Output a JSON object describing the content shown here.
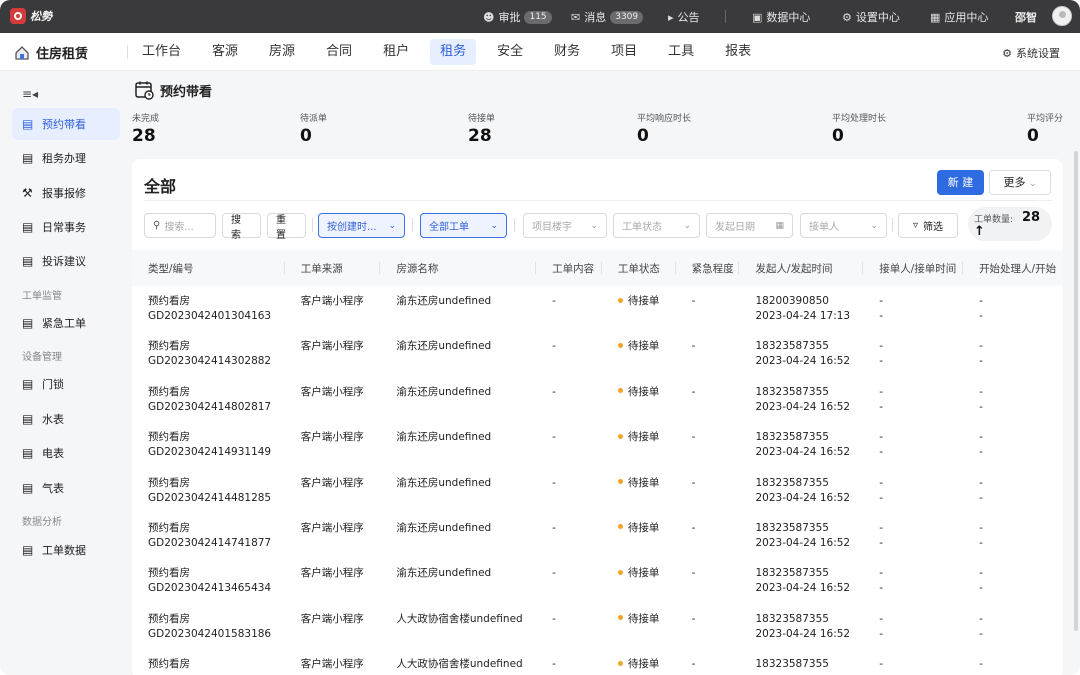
{
  "topbar": {
    "logo": "松勢",
    "approve_label": "审批",
    "approve_count": "115",
    "message_label": "消息",
    "message_count": "3309",
    "notice_label": "公告",
    "data_center": "数据中心",
    "settings_center": "设置中心",
    "app_center": "应用中心",
    "user": "邵智"
  },
  "nav": {
    "brand": "住房租赁",
    "tabs": [
      "工作台",
      "客源",
      "房源",
      "合同",
      "租户",
      "租务",
      "安全",
      "财务",
      "项目",
      "工具",
      "报表"
    ],
    "active_tab": "租务",
    "system_settings": "系统设置"
  },
  "sidebar": {
    "items": [
      {
        "label": "预约带看",
        "icon": "calendar-icon",
        "active": true
      },
      {
        "label": "租务办理",
        "icon": "document-icon"
      },
      {
        "label": "报事报修",
        "icon": "wrench-icon"
      },
      {
        "label": "日常事务",
        "icon": "clipboard-icon"
      },
      {
        "label": "投诉建议",
        "icon": "feedback-icon"
      }
    ],
    "group_monitor": "工单监管",
    "monitor_items": [
      {
        "label": "紧急工单",
        "icon": "alert-list-icon"
      }
    ],
    "group_device": "设备管理",
    "device_items": [
      {
        "label": "门锁",
        "icon": "lock-icon"
      },
      {
        "label": "水表",
        "icon": "water-meter-icon"
      },
      {
        "label": "电表",
        "icon": "electric-meter-icon"
      },
      {
        "label": "气表",
        "icon": "gas-meter-icon"
      }
    ],
    "group_analysis": "数据分析",
    "analysis_items": [
      {
        "label": "工单数据",
        "icon": "chart-icon"
      }
    ]
  },
  "page": {
    "title": "预约带看",
    "stats": [
      {
        "label": "未完成",
        "value": "28"
      },
      {
        "label": "待派单",
        "value": "0"
      },
      {
        "label": "待接单",
        "value": "28"
      },
      {
        "label": "平均响应时长",
        "value": "0"
      },
      {
        "label": "平均处理时长",
        "value": "0"
      },
      {
        "label": "平均评分",
        "value": "0"
      }
    ]
  },
  "card": {
    "title": "全部",
    "new_button": "新 建",
    "more_button": "更多",
    "search_placeholder": "搜索...",
    "search_button": "搜 索",
    "reset_button": "重 置",
    "sort_select": "按创建时...",
    "type_select": "全部工单",
    "project_select": "项目楼宇",
    "status_select": "工单状态",
    "date_select": "发起日期",
    "receiver_select": "接单人",
    "filter_button": "筛选",
    "count_label": "工单数量:",
    "count_value": "28"
  },
  "table": {
    "columns": [
      "类型/编号",
      "工单来源",
      "房源名称",
      "工单内容",
      "工单状态",
      "紧急程度",
      "发起人/发起时间",
      "接单人/接单时间",
      "开始处理人/开始"
    ],
    "rows": [
      {
        "type": "预约看房",
        "id": "GD2023042401304163",
        "source": "客户端小程序",
        "house": "渝东还房undefined",
        "content": "-",
        "status": "待接单",
        "urgency": "-",
        "initiator": "18200390850",
        "time": "2023-04-24 17:13",
        "receiver": "-",
        "rtime": "-",
        "handler": "-",
        "htime": "-"
      },
      {
        "type": "预约看房",
        "id": "GD2023042414302882",
        "source": "客户端小程序",
        "house": "渝东还房undefined",
        "content": "-",
        "status": "待接单",
        "urgency": "-",
        "initiator": "18323587355",
        "time": "2023-04-24 16:52",
        "receiver": "-",
        "rtime": "-",
        "handler": "-",
        "htime": "-"
      },
      {
        "type": "预约看房",
        "id": "GD2023042414802817",
        "source": "客户端小程序",
        "house": "渝东还房undefined",
        "content": "-",
        "status": "待接单",
        "urgency": "-",
        "initiator": "18323587355",
        "time": "2023-04-24 16:52",
        "receiver": "-",
        "rtime": "-",
        "handler": "-",
        "htime": "-"
      },
      {
        "type": "预约看房",
        "id": "GD2023042414931149",
        "source": "客户端小程序",
        "house": "渝东还房undefined",
        "content": "-",
        "status": "待接单",
        "urgency": "-",
        "initiator": "18323587355",
        "time": "2023-04-24 16:52",
        "receiver": "-",
        "rtime": "-",
        "handler": "-",
        "htime": "-"
      },
      {
        "type": "预约看房",
        "id": "GD2023042414481285",
        "source": "客户端小程序",
        "house": "渝东还房undefined",
        "content": "-",
        "status": "待接单",
        "urgency": "-",
        "initiator": "18323587355",
        "time": "2023-04-24 16:52",
        "receiver": "-",
        "rtime": "-",
        "handler": "-",
        "htime": "-"
      },
      {
        "type": "预约看房",
        "id": "GD2023042414741877",
        "source": "客户端小程序",
        "house": "渝东还房undefined",
        "content": "-",
        "status": "待接单",
        "urgency": "-",
        "initiator": "18323587355",
        "time": "2023-04-24 16:52",
        "receiver": "-",
        "rtime": "-",
        "handler": "-",
        "htime": "-"
      },
      {
        "type": "预约看房",
        "id": "GD2023042413465434",
        "source": "客户端小程序",
        "house": "渝东还房undefined",
        "content": "-",
        "status": "待接单",
        "urgency": "-",
        "initiator": "18323587355",
        "time": "2023-04-24 16:52",
        "receiver": "-",
        "rtime": "-",
        "handler": "-",
        "htime": "-"
      },
      {
        "type": "预约看房",
        "id": "GD2023042401583186",
        "source": "客户端小程序",
        "house": "人大政协宿舍楼undefined",
        "content": "-",
        "status": "待接单",
        "urgency": "-",
        "initiator": "18323587355",
        "time": "2023-04-24 16:52",
        "receiver": "-",
        "rtime": "-",
        "handler": "-",
        "htime": "-"
      },
      {
        "type": "预约看房",
        "id": "",
        "source": "客户端小程序",
        "house": "人大政协宿舍楼undefined",
        "content": "-",
        "status": "待接单",
        "urgency": "-",
        "initiator": "18323587355",
        "time": "",
        "receiver": "-",
        "rtime": "",
        "handler": "-",
        "htime": ""
      }
    ]
  }
}
